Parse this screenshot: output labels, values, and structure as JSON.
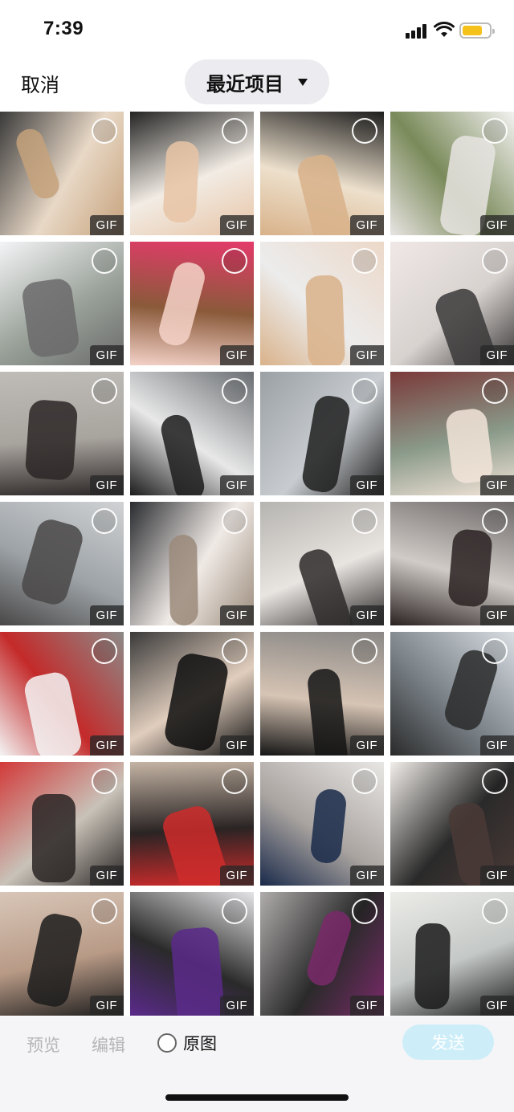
{
  "status_bar": {
    "time": "7:39"
  },
  "nav": {
    "cancel_label": "取消",
    "album_title": "最近项目"
  },
  "badge_label": "GIF",
  "grid": {
    "items": [
      {
        "colors": [
          "#3a3a3a",
          "#c6a27b",
          "#e8d8c6"
        ]
      },
      {
        "colors": [
          "#242424",
          "#e7c4a6",
          "#f2ece4"
        ]
      },
      {
        "colors": [
          "#1e1e1e",
          "#d8b28a",
          "#ede0cc"
        ]
      },
      {
        "colors": [
          "#f2f2f0",
          "#e8e4e2",
          "#7a8a5a"
        ]
      },
      {
        "colors": [
          "#f4f4f6",
          "#6a6a6a",
          "#9aa29a"
        ]
      },
      {
        "colors": [
          "#e43a6a",
          "#f4d2c8",
          "#8a5a3a"
        ]
      },
      {
        "colors": [
          "#ecd8c8",
          "#d9b28a",
          "#ececec"
        ]
      },
      {
        "colors": [
          "#efe8e6",
          "#3a3838",
          "#d8d2cf"
        ]
      },
      {
        "colors": [
          "#bfbcb8",
          "#2c2626",
          "#a8a49e"
        ]
      },
      {
        "colors": [
          "#6a6e72",
          "#1c1c1c",
          "#e8e8e8"
        ]
      },
      {
        "colors": [
          "#9aa0a4",
          "#1e1e1e",
          "#c8ccd0"
        ]
      },
      {
        "colors": [
          "#7a3a3a",
          "#f2e4d8",
          "#8a9a8a"
        ]
      },
      {
        "colors": [
          "#d0d2d4",
          "#4a4848",
          "#9ca2a6"
        ]
      },
      {
        "colors": [
          "#2a2c30",
          "#9a8a7a",
          "#f0eae6"
        ]
      },
      {
        "colors": [
          "#b6b4b0",
          "#2e2a2a",
          "#e8e4e0"
        ]
      },
      {
        "colors": [
          "#6e6a6a",
          "#2a2222",
          "#d0cbc6"
        ]
      },
      {
        "colors": [
          "#8c8a88",
          "#f4f4f4",
          "#c42a2a"
        ]
      },
      {
        "colors": [
          "#3a3a3a",
          "#0e0e0e",
          "#e0cdbd"
        ]
      },
      {
        "colors": [
          "#8a8886",
          "#151515",
          "#d6c4b4"
        ]
      },
      {
        "colors": [
          "#d8dde2",
          "#2a2a2a",
          "#7a8288"
        ]
      },
      {
        "colors": [
          "#d23a3a",
          "#2a2424",
          "#c8c2b8"
        ]
      },
      {
        "colors": [
          "#c4b4a4",
          "#cf2b2b",
          "#2a2424"
        ]
      },
      {
        "colors": [
          "#e8e6e4",
          "#1a2a4a",
          "#aaa4a0"
        ]
      },
      {
        "colors": [
          "#f2eeea",
          "#4a3a36",
          "#2a2a2a"
        ]
      },
      {
        "colors": [
          "#d8c6b8",
          "#1c1c1c",
          "#b89a86"
        ]
      },
      {
        "colors": [
          "#e4e4e6",
          "#5a2a8a",
          "#2a2a2a"
        ]
      },
      {
        "colors": [
          "#b0acac",
          "#7a2a6a",
          "#2a2a2a"
        ]
      },
      {
        "colors": [
          "#ecece8",
          "#1a1a1a",
          "#c4c8c6"
        ]
      }
    ]
  },
  "toolbar": {
    "preview_label": "预览",
    "edit_label": "编辑",
    "original_label": "原图",
    "send_label": "发送"
  },
  "colors": {
    "send_button_bg": "#cdeef9",
    "accent_disabled": "#b5b5b8"
  }
}
